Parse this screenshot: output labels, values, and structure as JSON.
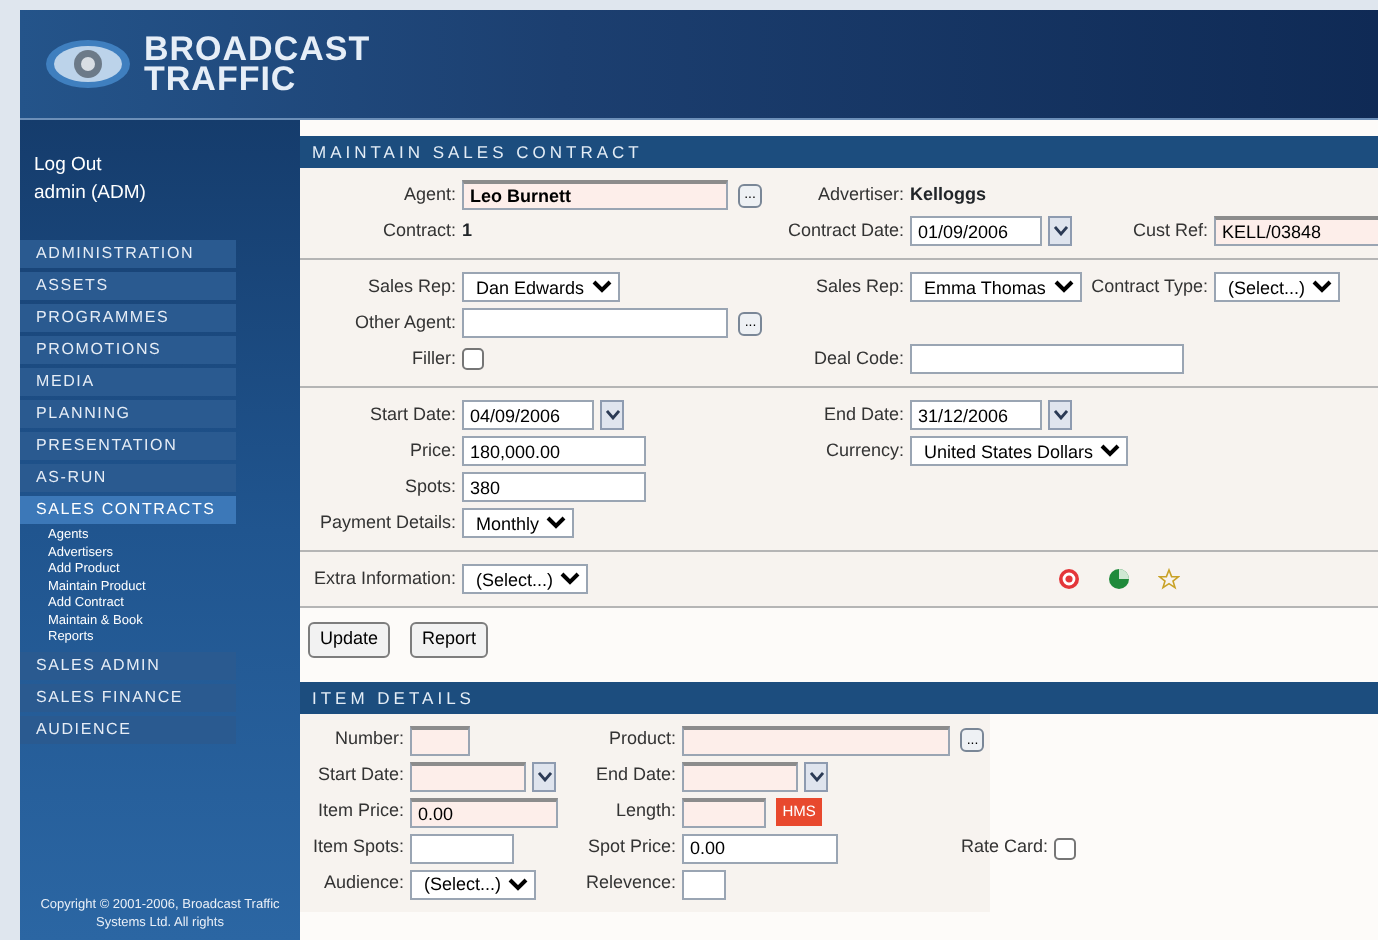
{
  "header": {
    "logo_lines": [
      "BROADCAST",
      "TRAFFIC"
    ]
  },
  "sidebar": {
    "user_links": [
      {
        "label": "Log Out"
      },
      {
        "label": "admin (ADM)"
      }
    ],
    "menu": [
      {
        "label": "ADMINISTRATION",
        "expanded": false
      },
      {
        "label": "ASSETS",
        "expanded": false
      },
      {
        "label": "PROGRAMMES",
        "expanded": false
      },
      {
        "label": "PROMOTIONS",
        "expanded": false
      },
      {
        "label": "MEDIA",
        "expanded": false
      },
      {
        "label": "PLANNING",
        "expanded": false
      },
      {
        "label": "PRESENTATION",
        "expanded": false
      },
      {
        "label": "AS-RUN",
        "expanded": false
      },
      {
        "label": "SALES CONTRACTS",
        "expanded": true,
        "children": [
          "Agents",
          "Advertisers",
          "Add Product",
          "Maintain Product",
          "Add Contract",
          "Maintain & Book",
          "Reports"
        ]
      },
      {
        "label": "SALES ADMIN",
        "expanded": false
      },
      {
        "label": "SALES FINANCE",
        "expanded": false
      },
      {
        "label": "AUDIENCE",
        "expanded": false
      }
    ],
    "copyright": "Copyright © 2001-2006, Broadcast Traffic Systems Ltd. All rights"
  },
  "sections": [
    {
      "title": "MAINTAIN SALES CONTRACT",
      "kind": "contract",
      "groups": [
        {
          "rows": [
            [
              {
                "kind": "lookup",
                "label": "Agent:",
                "value": "Leo Burnett",
                "required": true,
                "bold": true,
                "button": "..."
              },
              {
                "kind": "static",
                "label": "Advertiser:",
                "value": "Kelloggs"
              }
            ],
            [
              {
                "kind": "static",
                "label": "Contract:",
                "value": "1"
              },
              {
                "kind": "date",
                "label": "Contract Date:",
                "value": "01/09/2006"
              },
              {
                "kind": "text",
                "label": "Cust Ref:",
                "value": "KELL/03848",
                "required": true
              }
            ]
          ]
        },
        {
          "rows": [
            [
              {
                "kind": "select",
                "label": "Sales Rep:",
                "value": "Dan Edwards"
              },
              {
                "kind": "select",
                "label": "Sales Rep:",
                "value": "Emma Thomas"
              },
              {
                "kind": "select",
                "label": "Contract Type:",
                "value": "(Select...)"
              }
            ],
            [
              {
                "kind": "lookup",
                "label": "Other Agent:",
                "button": "..."
              }
            ],
            [
              {
                "kind": "checkbox",
                "label": "Filler:",
                "checked": false
              },
              {
                "kind": "text",
                "label": "Deal Code:"
              }
            ]
          ]
        },
        {
          "rows": [
            [
              {
                "kind": "date",
                "label": "Start Date:",
                "value": "04/09/2006"
              },
              {
                "kind": "date",
                "label": "End Date:",
                "value": "31/12/2006"
              }
            ],
            [
              {
                "kind": "text",
                "label": "Price:",
                "value": "180,000.00"
              },
              {
                "kind": "select",
                "label": "Currency:",
                "value": "United States Dollars"
              }
            ],
            [
              {
                "kind": "text",
                "label": "Spots:",
                "value": "380"
              }
            ],
            [
              {
                "kind": "select",
                "label": "Payment Details:",
                "value": "Monthly"
              }
            ]
          ]
        },
        {
          "icons": true,
          "rows": [
            [
              {
                "kind": "select",
                "label": "Extra Information:",
                "value": "(Select...)"
              }
            ]
          ]
        }
      ],
      "buttons": [
        "Update",
        "Report"
      ]
    },
    {
      "title": "ITEM DETAILS",
      "kind": "items",
      "groups": [
        {
          "rows": [
            [
              {
                "kind": "text",
                "label": "Number:",
                "required": true
              },
              {
                "kind": "lookup",
                "label": "Product:",
                "required": true,
                "button": "..."
              }
            ],
            [
              {
                "kind": "date",
                "label": "Start Date:",
                "required": true
              },
              {
                "kind": "date",
                "label": "End Date:",
                "required": true
              }
            ],
            [
              {
                "kind": "text",
                "label": "Item Price:",
                "value": "0.00",
                "required": true
              },
              {
                "kind": "text",
                "label": "Length:",
                "required": true,
                "badge": "HMS"
              }
            ],
            [
              {
                "kind": "text",
                "label": "Item Spots:"
              },
              {
                "kind": "text",
                "label": "Spot Price:",
                "value": "0.00"
              },
              {
                "kind": "checkbox",
                "label": "Rate Card:",
                "checked": false
              }
            ],
            [
              {
                "kind": "select",
                "label": "Audience:",
                "value": "(Select...)"
              },
              {
                "kind": "text",
                "label": "Relevence:"
              }
            ]
          ]
        }
      ]
    }
  ]
}
